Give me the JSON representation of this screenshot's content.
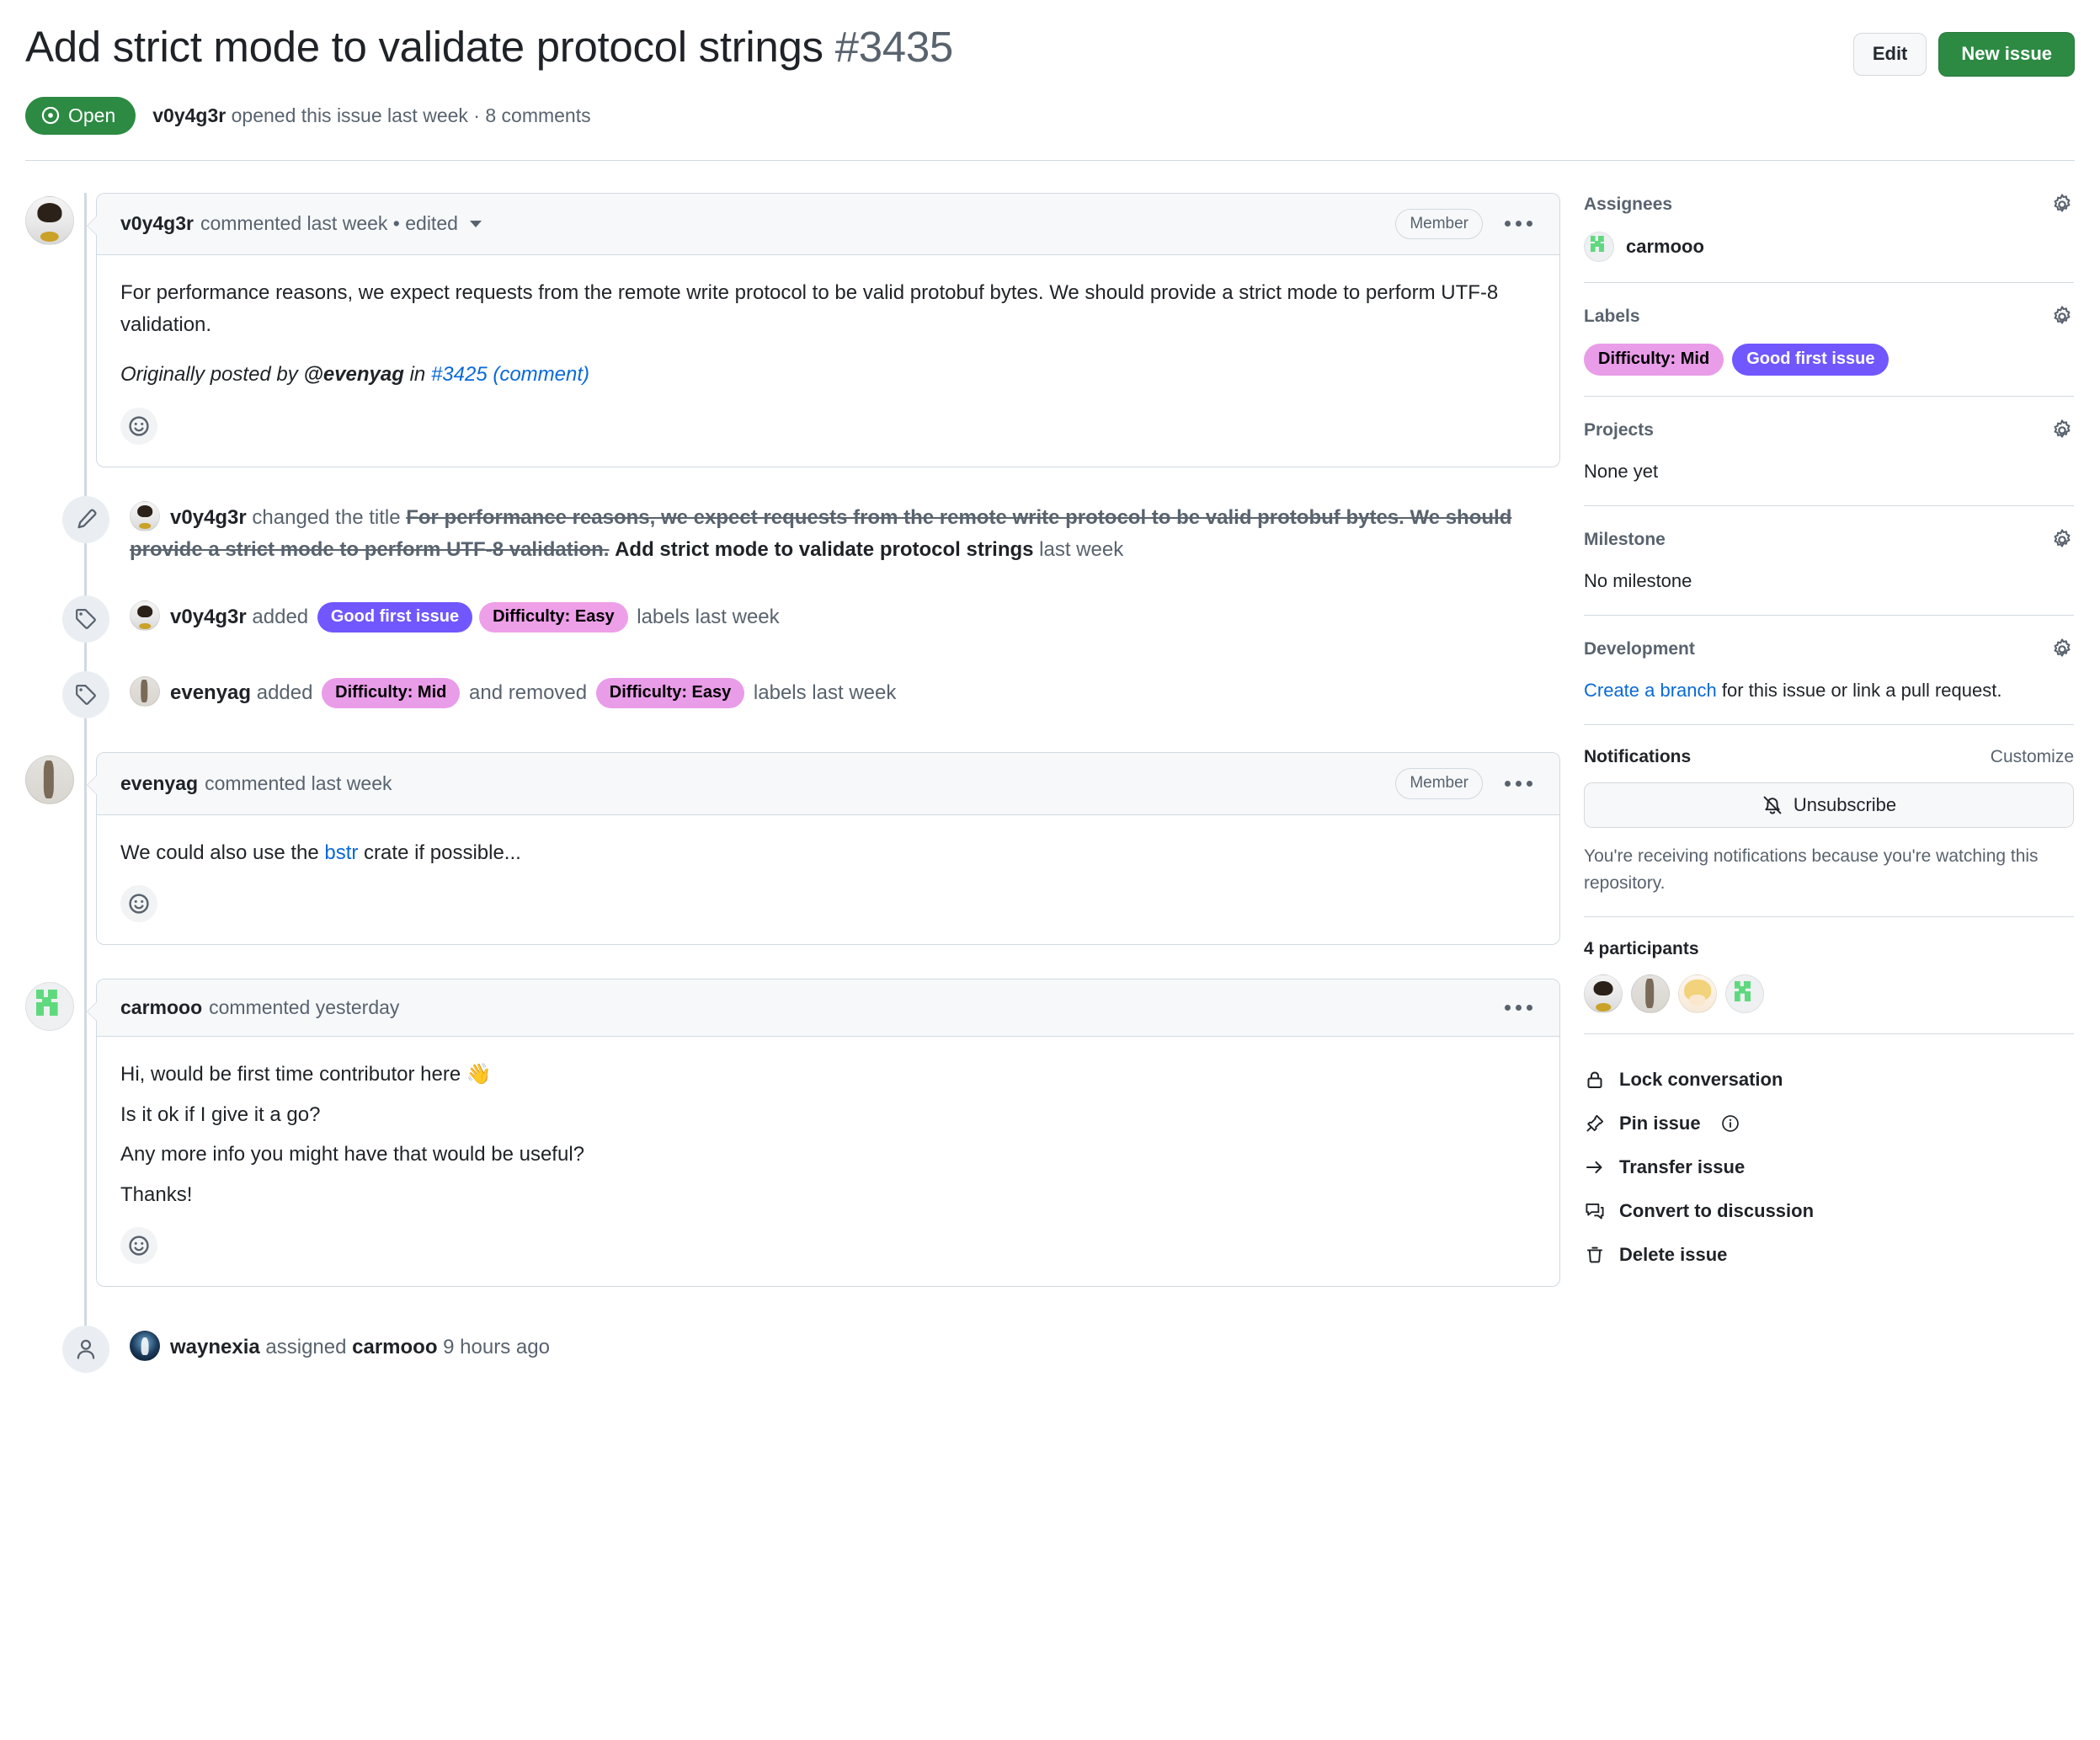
{
  "header": {
    "title": "Add strict mode to validate protocol strings",
    "number": "#3435",
    "edit_label": "Edit",
    "new_issue_label": "New issue",
    "state": "Open",
    "meta_author": "v0y4g3r",
    "meta_rest": " opened this issue last week · 8 comments"
  },
  "comments": [
    {
      "author": "v0y4g3r",
      "meta": "commented last week • edited",
      "role": "Member",
      "paragraphs": [
        "For performance reasons, we expect requests from the remote write protocol to be valid protobuf bytes. We should provide a strict mode to perform UTF-8 validation."
      ],
      "quote_prefix": "Originally posted by ",
      "quote_user": "@evenyag",
      "quote_mid": " in ",
      "quote_link": "#3425 (comment)"
    },
    {
      "author": "evenyag",
      "meta": "commented last week",
      "role": "Member",
      "line_prefix": "We could also use the ",
      "line_link": "bstr",
      "line_suffix": " crate if possible..."
    },
    {
      "author": "carmooo",
      "meta": "commented yesterday",
      "lines": [
        "Hi, would be first time contributor here 👋",
        "Is it ok if I give it a go?",
        "Any more info you might have that would be useful?",
        "Thanks!"
      ]
    }
  ],
  "events": {
    "title_change": {
      "actor": "v0y4g3r",
      "verb": " changed the title ",
      "old_title": "For performance reasons, we expect requests from the remote write protocol to be valid protobuf bytes. We should provide a strict mode to perform UTF-8 validation.",
      "new_title": "Add strict mode to validate protocol strings",
      "time": " last week"
    },
    "labels_added": {
      "actor": "v0y4g3r",
      "verb": " added ",
      "labels": [
        {
          "text": "Good first issue",
          "bg": "#7057ff",
          "fg": "#ffffff"
        },
        {
          "text": "Difficulty: Easy",
          "bg": "#ed9fe8",
          "fg": "#000000"
        }
      ],
      "time": " labels last week"
    },
    "labels_swapped": {
      "actor": "evenyag",
      "verb_added": " added ",
      "label_added": {
        "text": "Difficulty: Mid",
        "bg": "#e99ce8",
        "fg": "#000000"
      },
      "verb_removed": " and removed ",
      "label_removed": {
        "text": "Difficulty: Easy",
        "bg": "#e99ce8",
        "fg": "#000000"
      },
      "time": " labels last week"
    },
    "assigned": {
      "actor": "waynexia",
      "verb": " assigned ",
      "target": "carmooo",
      "time": " 9 hours ago"
    }
  },
  "sidebar": {
    "assignees": {
      "title": "Assignees",
      "name": "carmooo"
    },
    "labels": {
      "title": "Labels",
      "items": [
        {
          "text": "Difficulty: Mid",
          "bg": "#e99ce8",
          "fg": "#000000"
        },
        {
          "text": "Good first issue",
          "bg": "#7057ff",
          "fg": "#ffffff"
        }
      ]
    },
    "projects": {
      "title": "Projects",
      "value": "None yet"
    },
    "milestone": {
      "title": "Milestone",
      "value": "No milestone"
    },
    "development": {
      "title": "Development",
      "link": "Create a branch",
      "rest": " for this issue or link a pull request."
    },
    "notifications": {
      "title": "Notifications",
      "customize": "Customize",
      "button": "Unsubscribe",
      "note": "You're receiving notifications because you're watching this repository."
    },
    "participants": {
      "title": "4 participants"
    },
    "actions": [
      {
        "label": "Lock conversation",
        "icon": "lock-icon"
      },
      {
        "label": "Pin issue",
        "icon": "pin-icon"
      },
      {
        "label": "Transfer issue",
        "icon": "arrow-right-icon"
      },
      {
        "label": "Convert to discussion",
        "icon": "discussion-icon"
      },
      {
        "label": "Delete issue",
        "icon": "trash-icon"
      }
    ]
  }
}
